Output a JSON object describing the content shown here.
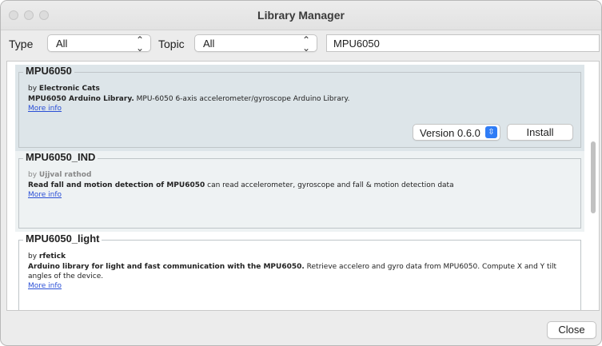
{
  "window": {
    "title": "Library Manager"
  },
  "filters": {
    "type_label": "Type",
    "type_value": "All",
    "topic_label": "Topic",
    "topic_value": "All",
    "search_value": "MPU6050"
  },
  "libraries": [
    {
      "name": "MPU6050",
      "by": "by",
      "author": "Electronic Cats",
      "summary": "MPU6050 Arduino Library.",
      "description": "MPU-6050 6-axis accelerometer/gyroscope Arduino Library.",
      "more_info": "More info",
      "version": "Version 0.6.0",
      "install_label": "Install"
    },
    {
      "name": "MPU6050_IND",
      "by": "by",
      "author": "Ujjval rathod",
      "summary": "Read fall and motion detection of MPU6050",
      "description": "can read accelerometer, gyroscope and fall & motion detection data",
      "more_info": "More info"
    },
    {
      "name": "MPU6050_light",
      "by": "by",
      "author": "rfetick",
      "summary": "Arduino library for light and fast communication with the MPU6050.",
      "description": "Retrieve accelero and gyro data from MPU6050. Compute X and Y tilt angles of the device.",
      "more_info": "More info"
    }
  ],
  "footer": {
    "close_label": "Close"
  }
}
